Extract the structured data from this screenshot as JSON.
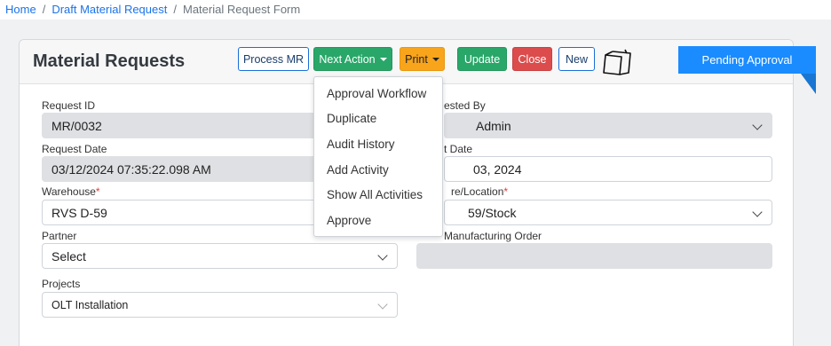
{
  "breadcrumb": {
    "home": "Home",
    "draft": "Draft Material Request",
    "current": "Material Request Form",
    "separator": "/"
  },
  "header": {
    "title": "Material Requests",
    "process_mr": "Process MR",
    "next_action": "Next Action",
    "print": "Print",
    "update": "Update",
    "close": "Close",
    "new": "New",
    "status_ribbon": "Pending Approval"
  },
  "dropdown": {
    "items": [
      "Approval Workflow",
      "Duplicate",
      "Audit History",
      "Add Activity",
      "Show All Activities",
      "Approve"
    ]
  },
  "form": {
    "request_id": {
      "label": "Request ID",
      "value": "MR/0032"
    },
    "request_date": {
      "label": "Request Date",
      "value": "03/12/2024 07:35:22.098 AM"
    },
    "warehouse": {
      "label": "Warehouse",
      "required": "*",
      "value": "RVS D-59"
    },
    "partner": {
      "label": "Partner",
      "value": "Select"
    },
    "projects": {
      "label": "Projects",
      "value": "OLT Installation"
    },
    "requested_by": {
      "label": "ested By",
      "value": "Admin"
    },
    "start_date": {
      "label": "t Date",
      "value": "03, 2024"
    },
    "store_location": {
      "label": "re/Location",
      "required": "*",
      "value": "59/Stock"
    },
    "manufacturing_order": {
      "label": "Manufacturing Order",
      "value": ""
    }
  },
  "colors": {
    "primary_blue": "#1a8cff",
    "green": "#28a769",
    "orange": "#f8a51c",
    "red": "#dc4c4c"
  },
  "icons": {
    "sticky_note": "sticky-note-icon"
  }
}
